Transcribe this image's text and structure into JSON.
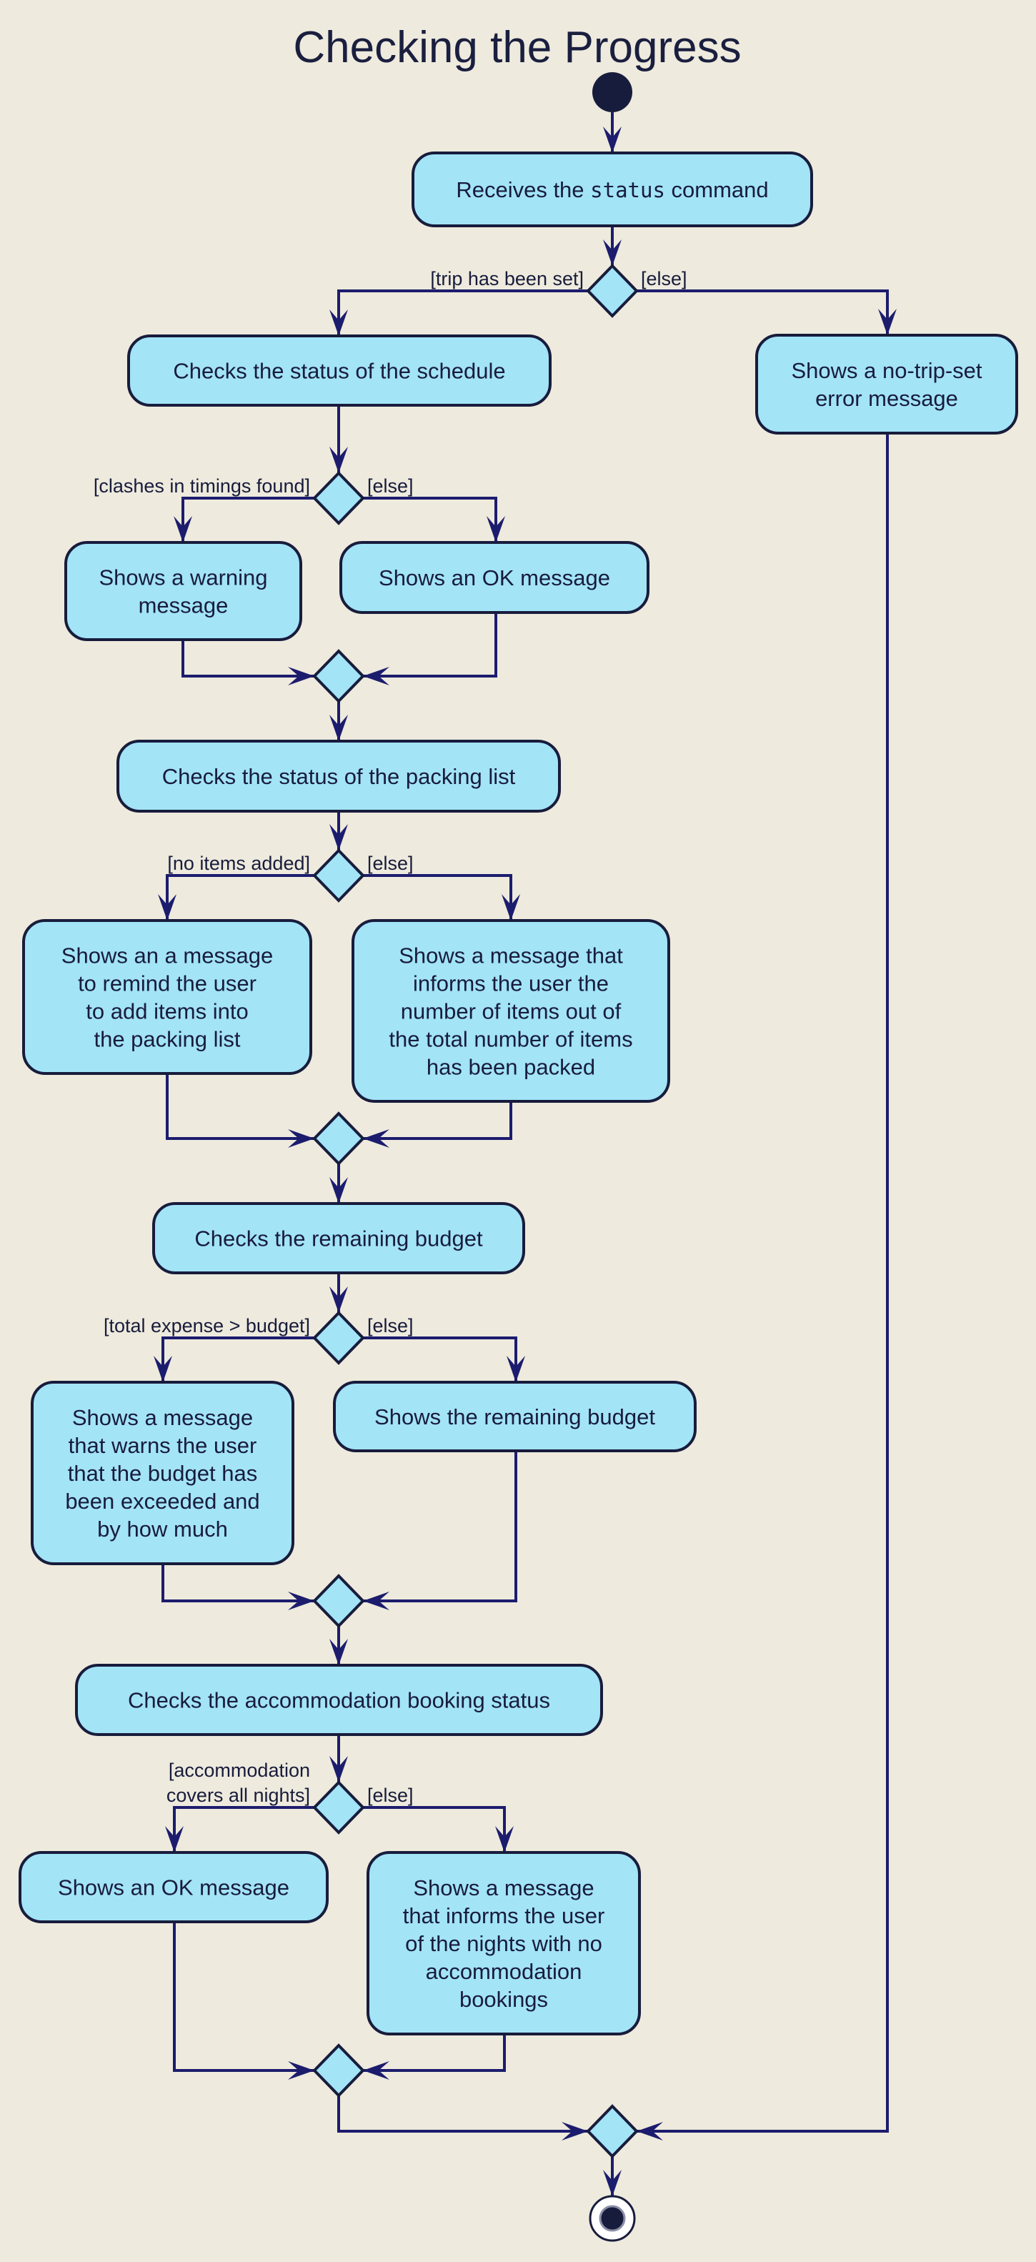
{
  "diagram": {
    "title": "Checking the Progress",
    "type": "UML activity diagram",
    "colors": {
      "background": "#EEEADD",
      "activity_fill": "#A3E4F7",
      "border": "#181C3C",
      "edge": "#1c1c6e"
    },
    "activities": {
      "receive": {
        "parts": [
          {
            "text": "Receives the "
          },
          {
            "text": "status",
            "mono": true
          },
          {
            "text": " command"
          }
        ]
      },
      "schedule": {
        "lines": [
          "Checks the status of the schedule"
        ]
      },
      "no_trip": {
        "lines": [
          "Shows a no-trip-set",
          "error message"
        ]
      },
      "warning": {
        "lines": [
          "Shows a warning",
          "message"
        ]
      },
      "ok1": {
        "lines": [
          "Shows an OK message"
        ]
      },
      "packing": {
        "lines": [
          "Checks the status of the packing list"
        ]
      },
      "remind": {
        "lines": [
          "Shows an a message",
          "to remind the user",
          "to add items into",
          "the packing list"
        ]
      },
      "packed": {
        "lines": [
          "Shows a message that",
          "informs the user the",
          "number of items out of",
          "the total number of items",
          "has been packed"
        ]
      },
      "budget": {
        "lines": [
          "Checks the remaining budget"
        ]
      },
      "exceeded": {
        "lines": [
          "Shows a message",
          "that warns the user",
          "that the budget has",
          "been exceeded and",
          "by how much"
        ]
      },
      "remaining": {
        "lines": [
          "Shows the remaining budget"
        ]
      },
      "accom": {
        "lines": [
          "Checks the accommodation booking status"
        ]
      },
      "ok2": {
        "lines": [
          "Shows an OK message"
        ]
      },
      "nights": {
        "lines": [
          "Shows a message",
          "that informs the user",
          "of the nights with no",
          "accommodation",
          "bookings"
        ]
      }
    },
    "guards": {
      "d1_left": [
        "[trip has been set]"
      ],
      "d1_right": [
        "[else]"
      ],
      "d2_left": [
        "[clashes in timings found]"
      ],
      "d2_right": [
        "[else]"
      ],
      "d3_left": [
        "[no items added]"
      ],
      "d3_right": [
        "[else]"
      ],
      "d4_left": [
        "[total expense > budget]"
      ],
      "d4_right": [
        "[else]"
      ],
      "d5_left": [
        "[accommodation",
        " covers all nights]"
      ],
      "d5_right": [
        "[else]"
      ]
    }
  }
}
